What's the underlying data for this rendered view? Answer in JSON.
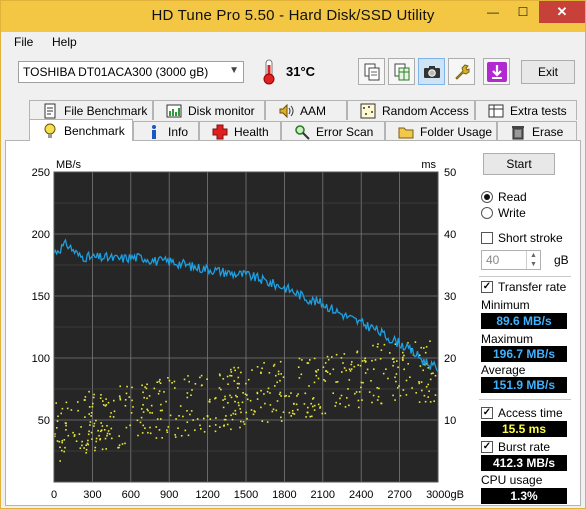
{
  "window": {
    "title": "HD Tune Pro 5.50 - Hard Disk/SSD Utility",
    "minimize": "—",
    "maximize": "☐",
    "close": "✕"
  },
  "menu": {
    "file": "File",
    "help": "Help"
  },
  "toolbar": {
    "drive": "TOSHIBA DT01ACA300 (3000 gB)",
    "temperature": "31°C",
    "exit_label": "Exit",
    "icons": [
      "copy-text-icon",
      "copy-spreadsheet-icon",
      "screenshot-camera-icon",
      "options-wrench-icon",
      "save-download-icon"
    ]
  },
  "tabs_row1": [
    "File Benchmark",
    "Disk monitor",
    "AAM",
    "Random Access",
    "Extra tests"
  ],
  "tabs_row2": [
    "Benchmark",
    "Info",
    "Health",
    "Error Scan",
    "Folder Usage",
    "Erase"
  ],
  "side": {
    "start_label": "Start",
    "read_label": "Read",
    "write_label": "Write",
    "short_stroke_label": "Short stroke",
    "short_stroke_value": "40",
    "short_stroke_unit": "gB",
    "transfer_rate_label": "Transfer rate",
    "minimum_label": "Minimum",
    "minimum_value": "89.6 MB/s",
    "maximum_label": "Maximum",
    "maximum_value": "196.7 MB/s",
    "average_label": "Average",
    "average_value": "151.9 MB/s",
    "access_time_label": "Access time",
    "access_time_value": "15.5 ms",
    "burst_rate_label": "Burst rate",
    "burst_rate_value": "412.3 MB/s",
    "cpu_usage_label": "CPU usage",
    "cpu_usage_value": "1.3%"
  },
  "colors": {
    "transfer_line": "#1e9fe0",
    "access_points": "#e8e83a",
    "minimum_text": "#3fb3ff",
    "maximum_text": "#3fb3ff",
    "average_text": "#3fb3ff",
    "access_time_text": "#ffff40",
    "burst_rate_text": "#ffffff",
    "cpu_text": "#ffffff"
  },
  "chart_data": {
    "type": "line",
    "left_unit": "MB/s",
    "right_unit": "ms",
    "x_unit": "gB",
    "xlim": [
      0,
      3000
    ],
    "ylim_left": [
      0,
      250
    ],
    "ylim_right": [
      0,
      50
    ],
    "x_ticks": [
      "0",
      "300",
      "600",
      "900",
      "1200",
      "1500",
      "1800",
      "2100",
      "2400",
      "2700",
      "3000gB"
    ],
    "y_left_ticks": [
      "250",
      "200",
      "150",
      "100",
      "50"
    ],
    "y_right_ticks": [
      "50",
      "40",
      "30",
      "20",
      "10"
    ],
    "grid": true,
    "series": [
      {
        "name": "Transfer rate",
        "axis": "left",
        "x": [
          0,
          100,
          200,
          300,
          400,
          500,
          600,
          700,
          800,
          900,
          1000,
          1100,
          1200,
          1300,
          1400,
          1500,
          1600,
          1700,
          1800,
          1900,
          2000,
          2100,
          2200,
          2300,
          2400,
          2500,
          2600,
          2700,
          2800,
          2900,
          3000
        ],
        "values": [
          185,
          192,
          182,
          181,
          181,
          180,
          181,
          181,
          178,
          178,
          176,
          173,
          172,
          170,
          168,
          167,
          164,
          160,
          157,
          152,
          147,
          144,
          138,
          133,
          128,
          124,
          117,
          112,
          105,
          97,
          91
        ]
      },
      {
        "name": "Access time",
        "axis": "right",
        "type": "scatter",
        "x": [
          0,
          300,
          600,
          900,
          1200,
          1500,
          1800,
          2100,
          2400,
          2700,
          3000
        ],
        "values": [
          8,
          10,
          11,
          12,
          13,
          14,
          15,
          16,
          17,
          18,
          18
        ]
      }
    ]
  }
}
